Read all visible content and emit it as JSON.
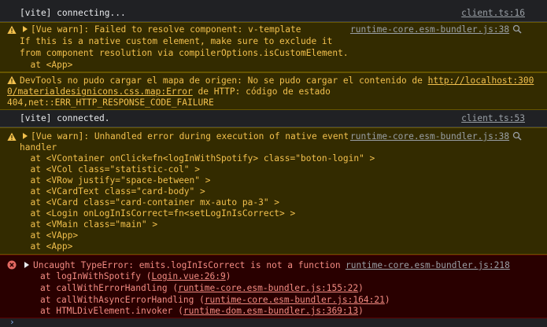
{
  "rows": {
    "r1": {
      "text": "[vite] connecting...",
      "source": "client.ts:16"
    },
    "r2": {
      "lines": [
        "[Vue warn]: Failed to resolve component: v-template",
        "If this is a native custom element, make sure to exclude it",
        "from component resolution via compilerOptions.isCustomElement.",
        "  at <App>"
      ],
      "source": "runtime-core.esm-bundler.js:38"
    },
    "r3": {
      "l1_pre": "DevTools no pudo cargar el mapa de origen: No se pudo cargar el contenido de ",
      "l1_link": "http://localhost:300",
      "l2_link": "0/materialdesignicons.css.map:Error",
      "l2_post": " de HTTP: código de estado",
      "l3": "404,net::ERR_HTTP_RESPONSE_CODE_FAILURE"
    },
    "r4": {
      "text": "[vite] connected.",
      "source": "client.ts:53"
    },
    "r5": {
      "lines": [
        "[Vue warn]: Unhandled error during execution of native event",
        "handler",
        "  at <VContainer onClick=fn<logInWithSpotify> class=\"boton-login\" >",
        "  at <VCol class=\"statistic-col\" >",
        "  at <VRow justify=\"space-between\" >",
        "  at <VCardText class=\"card-body\" >",
        "  at <VCard class=\"card-container mx-auto pa-3\" >",
        "  at <Login onLogInIsCorrect=fn<setLogInIsCorrect> >",
        "  at <VMain class=\"main\" >",
        "  at <VApp>",
        "  at <App>"
      ],
      "source": "runtime-core.esm-bundler.js:38"
    },
    "r6": {
      "head": "Uncaught TypeError: emits.logInIsCorrect is not a function",
      "source": "runtime-core.esm-bundler.js:218",
      "stack": [
        {
          "pre": "at logInWithSpotify (",
          "link": "Login.vue:26:9",
          "post": ")"
        },
        {
          "pre": "at callWithErrorHandling (",
          "link": "runtime-core.esm-bundler.js:155:22",
          "post": ")"
        },
        {
          "pre": "at callWithAsyncErrorHandling (",
          "link": "runtime-core.esm-bundler.js:164:21",
          "post": ")"
        },
        {
          "pre": "at HTMLDivElement.invoker (",
          "link": "runtime-dom.esm-bundler.js:369:13",
          "post": ")"
        }
      ]
    }
  },
  "prompt_symbol": "›",
  "colors": {
    "warn_bg": "#332b00",
    "warn_text": "#f2c04d",
    "err_bg": "#290000",
    "err_text": "#f28b82",
    "prompt": "#8ab4f8"
  }
}
